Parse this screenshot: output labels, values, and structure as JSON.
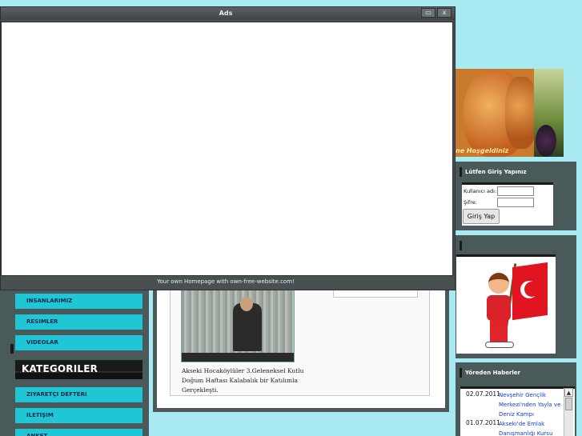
{
  "ads_window": {
    "title": "Ads",
    "minimize_icon": "▭",
    "close_icon": "x",
    "footer": "Your own Homepage with own-free-website.com!"
  },
  "sidebar": {
    "menu": [
      "INSANLARIMIZ",
      "RESIMLER",
      "VIDEOLAR"
    ],
    "categories_title": "KATEGORILER",
    "menu_after": [
      "ZIYARETÇI DEFTERI",
      "ILETIŞIM",
      "ANKET"
    ]
  },
  "article": {
    "caption": "Akseki Hocaköylüler 3.Geleneksel Kutlu Doğum Haftası Kalabalık bir Katılımla Gerçekleşti."
  },
  "header_image": {
    "welcome": "ne Hoşgeldiniz"
  },
  "login": {
    "title": "Lütfen Giriş Yapınız",
    "username_label": "Kullanıcı adı:",
    "password_label": "Şifre:",
    "username_value": "",
    "password_value": "",
    "submit_label": "Giriş Yap"
  },
  "news": {
    "title": "Yöreden Haberler",
    "items": [
      {
        "date": "02.07.2011",
        "text": "Nevşehir Gençlik Merkezi'nden Yayla ve Deniz Kampı"
      },
      {
        "date": "01.07.2011",
        "text": "Akseki'de Emlak Danışmanlığı Kursu"
      }
    ],
    "scroll_up_icon": "▲"
  }
}
